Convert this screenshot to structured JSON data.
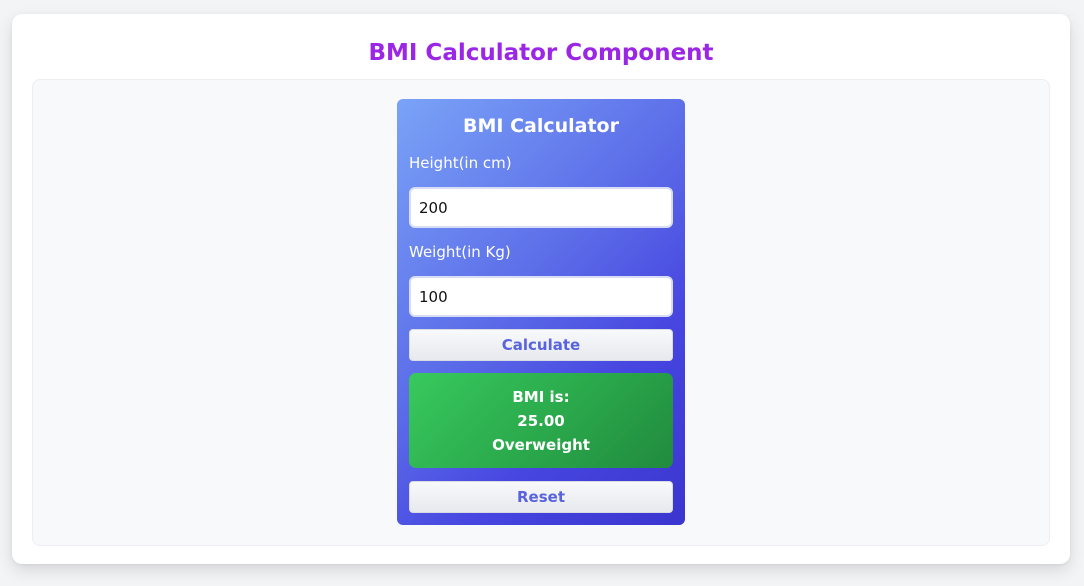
{
  "page": {
    "title": "BMI Calculator Component"
  },
  "calculator": {
    "title": "BMI Calculator",
    "height_label": "Height(in cm)",
    "height_value": "200",
    "weight_label": "Weight(in Kg)",
    "weight_value": "100",
    "calculate_label": "Calculate",
    "reset_label": "Reset",
    "result": {
      "heading": "BMI is:",
      "value": "25.00",
      "category": "Overweight"
    }
  },
  "colors": {
    "title": "#9b26e6",
    "card_gradient_start": "#7aa3f7",
    "card_gradient_end": "#3b35cf",
    "result_green": "#2aa84b",
    "button_text": "#5863dd"
  }
}
